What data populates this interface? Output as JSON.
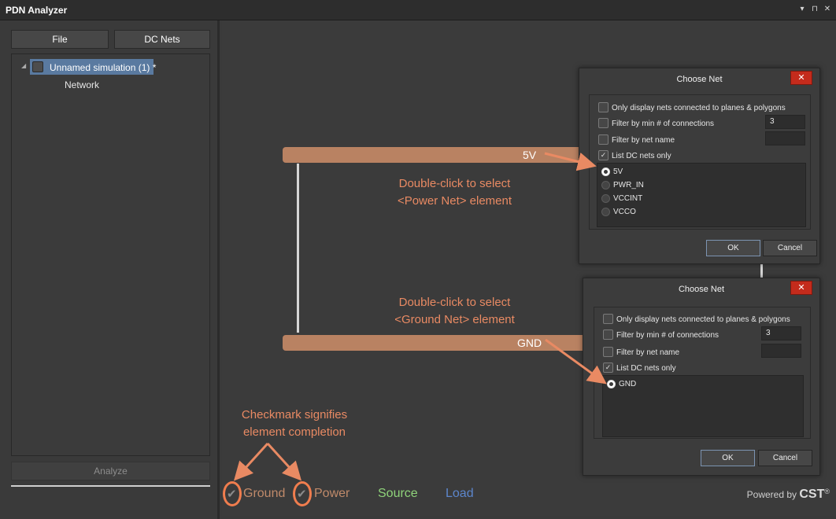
{
  "window": {
    "title": "PDN Analyzer",
    "controls": [
      "▾",
      "⊓",
      "✕"
    ]
  },
  "left": {
    "file_label": "File",
    "dcnets_label": "DC Nets",
    "tree": {
      "root": "Unnamed simulation (1) *",
      "child": "Network"
    },
    "analyze_label": "Analyze"
  },
  "diagram": {
    "power_rail": "5V",
    "ground_rail": "GND",
    "hint_power_line1": "Double-click to select",
    "hint_power_line2": "<Power Net> element",
    "hint_ground_line1": "Double-click to select",
    "hint_ground_line2": "<Ground Net> element",
    "hint_check_line1": "Checkmark signifies",
    "hint_check_line2": "element completion"
  },
  "legend": {
    "ground": "Ground",
    "power": "Power",
    "source": "Source",
    "load": "Load"
  },
  "colors": {
    "ground": "#c08a6a",
    "power": "#c08a6a",
    "source": "#8fd37a",
    "load": "#5c86cc",
    "annotation": "#e98a63",
    "rail": "#b98262"
  },
  "powered_by": {
    "prefix": "Powered by",
    "brand": "CST",
    "mark": "®"
  },
  "dialog_power": {
    "title": "Choose Net",
    "close": "✕",
    "opt_planes": "Only display nets connected to planes & polygons",
    "opt_min_conn": "Filter by min # of connections",
    "min_conn_value": "3",
    "opt_net_name": "Filter by net name",
    "opt_dc_only": "List DC nets only",
    "nets": [
      "5V",
      "PWR_IN",
      "VCCINT",
      "VCCO"
    ],
    "selected": "5V",
    "ok": "OK",
    "cancel": "Cancel"
  },
  "dialog_ground": {
    "title": "Choose Net",
    "close": "✕",
    "opt_planes": "Only display nets connected to planes & polygons",
    "opt_min_conn": "Filter by min # of connections",
    "min_conn_value": "3",
    "opt_net_name": "Filter by net name",
    "opt_dc_only": "List DC nets only",
    "nets": [
      "GND"
    ],
    "selected": "GND",
    "ok": "OK",
    "cancel": "Cancel"
  }
}
